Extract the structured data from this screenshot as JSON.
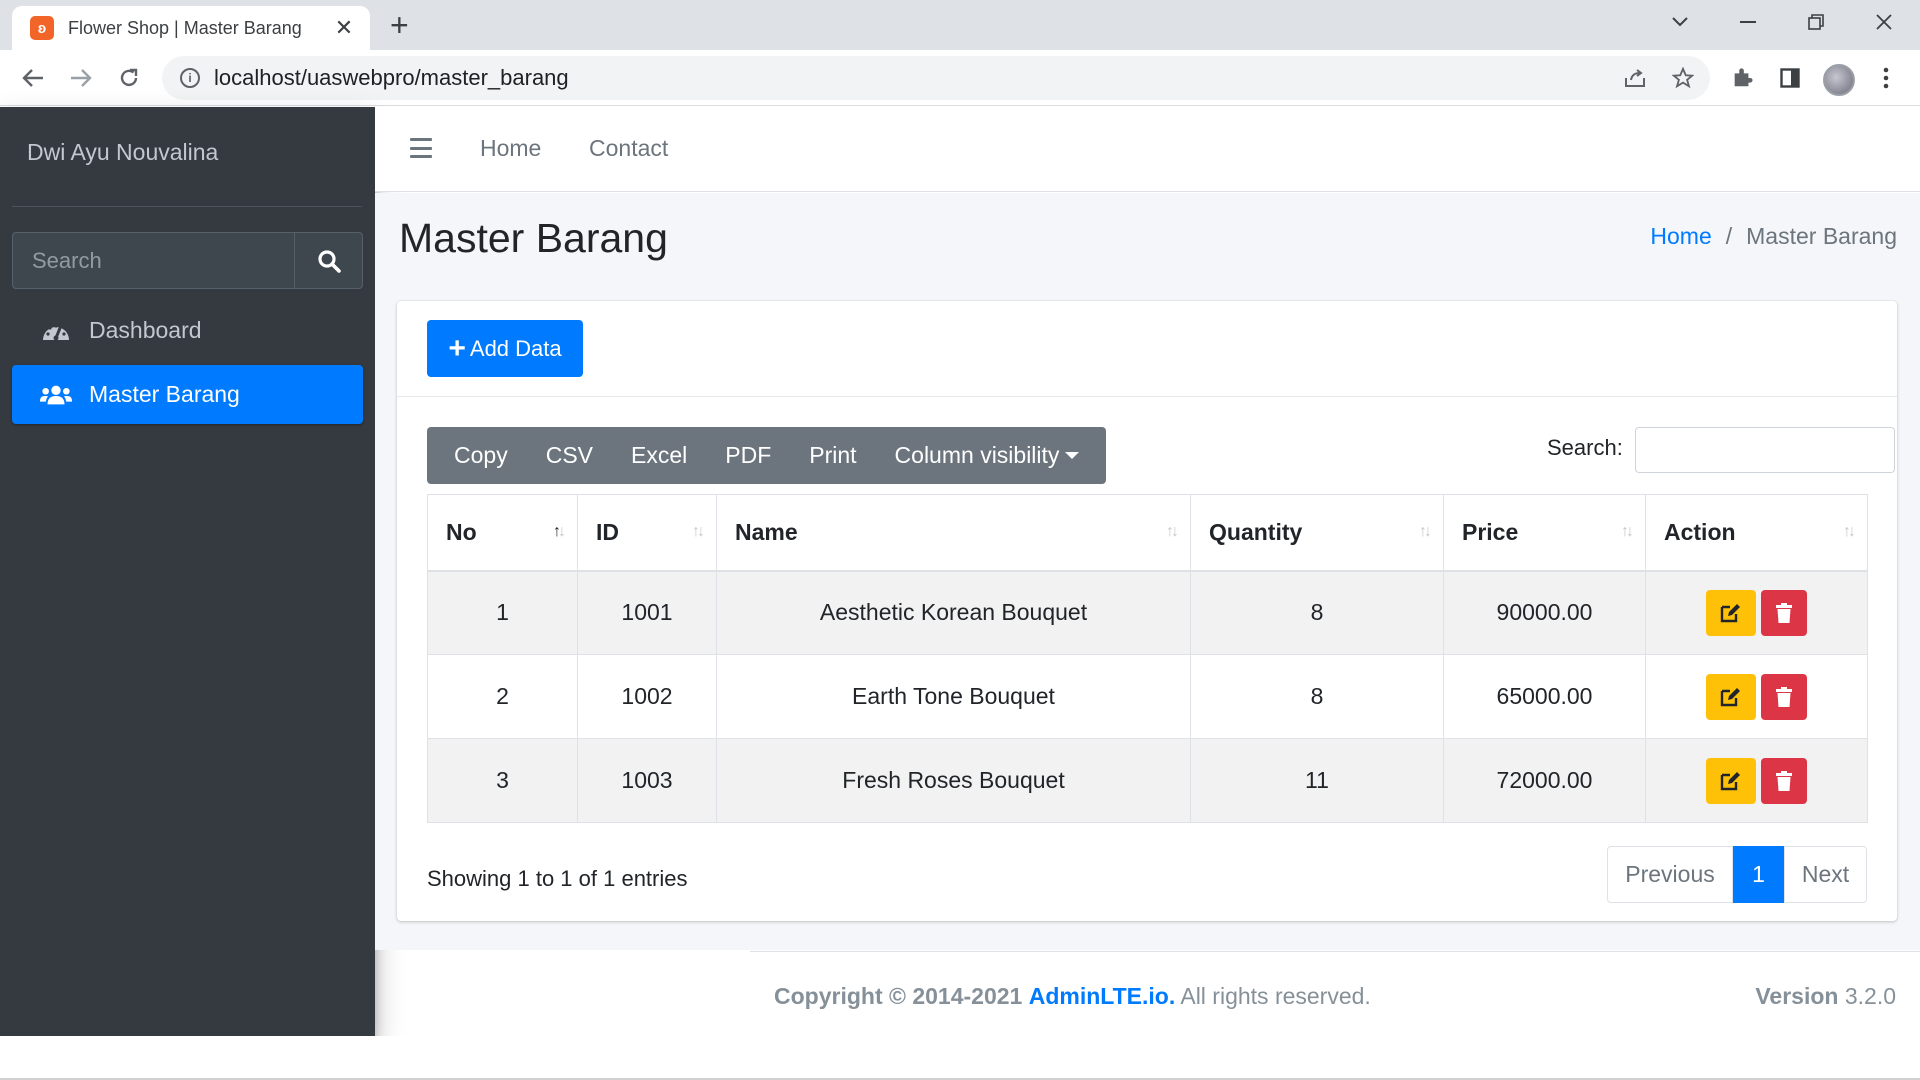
{
  "browser": {
    "tab_title": "Flower Shop | Master Barang",
    "tab_favicon": "xampp-icon",
    "url": "localhost/uaswebpro/master_barang"
  },
  "sidebar": {
    "brand": "Dwi Ayu Nouvalina",
    "search_placeholder": "Search",
    "items": [
      {
        "label": "Dashboard",
        "icon": "tachometer-icon",
        "active": false
      },
      {
        "label": "Master Barang",
        "icon": "users-icon",
        "active": true
      }
    ]
  },
  "topnav": {
    "links": [
      "Home",
      "Contact"
    ]
  },
  "page": {
    "title": "Master Barang",
    "breadcrumb": {
      "home": "Home",
      "separator": "/",
      "current": "Master Barang"
    }
  },
  "card": {
    "add_button": "Add Data",
    "export_buttons": [
      "Copy",
      "CSV",
      "Excel",
      "PDF",
      "Print",
      "Column visibility"
    ],
    "search_label": "Search:",
    "table": {
      "columns": [
        "No",
        "ID",
        "Name",
        "Quantity",
        "Price",
        "Action"
      ],
      "rows": [
        {
          "no": "1",
          "id": "1001",
          "name": "Aesthetic Korean Bouquet",
          "quantity": "8",
          "price": "90000.00"
        },
        {
          "no": "2",
          "id": "1002",
          "name": "Earth Tone Bouquet",
          "quantity": "8",
          "price": "65000.00"
        },
        {
          "no": "3",
          "id": "1003",
          "name": "Fresh Roses Bouquet",
          "quantity": "11",
          "price": "72000.00"
        }
      ]
    },
    "info": "Showing 1 to 1 of 1 entries",
    "pagination": {
      "previous": "Previous",
      "current": "1",
      "next": "Next"
    }
  },
  "footer": {
    "copyright_prefix": "Copyright © 2014-2021",
    "copyright_link": "AdminLTE.io.",
    "copyright_suffix": "All rights reserved.",
    "version_label": "Version",
    "version_value": "3.2.0"
  },
  "colors": {
    "primary": "#007bff",
    "sidebar_bg": "#343a40",
    "warning": "#ffc107",
    "danger": "#dc3545",
    "secondary": "#6c757d"
  }
}
